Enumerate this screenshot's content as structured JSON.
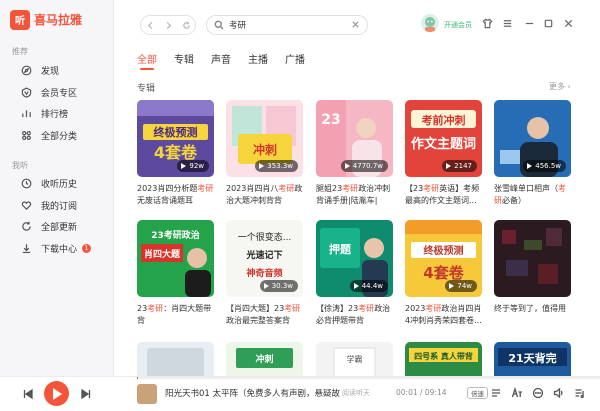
{
  "app": {
    "logo_char": "听",
    "name": "喜马拉雅"
  },
  "sidebar": {
    "section_recommend": "推荐",
    "recommend_items": [
      {
        "label": "发现",
        "icon": "compass-icon"
      },
      {
        "label": "会员专区",
        "icon": "vip-icon"
      },
      {
        "label": "排行榜",
        "icon": "ranking-icon"
      },
      {
        "label": "全部分类",
        "icon": "category-icon"
      }
    ],
    "section_mine": "我听",
    "mine_items": [
      {
        "label": "收听历史",
        "icon": "clock-icon"
      },
      {
        "label": "我的订阅",
        "icon": "heart-icon"
      },
      {
        "label": "全部更新",
        "icon": "refresh-icon"
      },
      {
        "label": "下载中心",
        "icon": "download-icon",
        "badge": "1"
      }
    ]
  },
  "search": {
    "value": "考研"
  },
  "topbar": {
    "vip_label": "开通会员"
  },
  "tabs": [
    "全部",
    "专辑",
    "声音",
    "主播",
    "广播"
  ],
  "active_tab": 0,
  "section": {
    "label": "专辑",
    "more": "更多 ›"
  },
  "albums": [
    {
      "pre": "2023肖四分析题",
      "kw": "考研",
      "post": "无废话背诵题耳",
      "plays": "92w",
      "art": "purple-yellow"
    },
    {
      "pre": "2023肖四肖八",
      "kw": "考研",
      "post": "政治大题冲刺背背",
      "plays": "353.3w",
      "art": "pink-mint"
    },
    {
      "pre": "腿姐23",
      "kw": "考研",
      "post": "政治冲刺背诵手册|陆胤车|大...",
      "plays": "4770.7w",
      "art": "pink-person"
    },
    {
      "pre": "【23",
      "kw": "考研",
      "post": "英语】考频最高的作文主题词...",
      "plays": "2147",
      "art": "red-orange"
    },
    {
      "pre": "张雪峰单口相声（",
      "kw": "考研",
      "post": "必备）",
      "plays": "456.5w",
      "art": "blue-person"
    },
    {
      "pre": "23",
      "kw": "考研",
      "post": "：肖四大题带背",
      "plays": "",
      "art": "green-person"
    },
    {
      "pre": "【肖四大题】23",
      "kw": "考研",
      "post": "政治最完整答案背诵...",
      "plays": "30.3w",
      "art": "white-text"
    },
    {
      "pre": "【徐涛】23",
      "kw": "考研",
      "post": "政治必背押题带背",
      "plays": "44.4w",
      "art": "green-teal"
    },
    {
      "pre": "2023",
      "kw": "考研",
      "post": "政治肖四肖4冲刺肖秀荣四套卷...",
      "plays": "74w",
      "art": "yellow-orange"
    },
    {
      "pre": "终于等到了，值得用",
      "kw": "",
      "post": "",
      "plays": "",
      "art": "dark-pixel"
    },
    {
      "pre": "",
      "kw": "",
      "post": "",
      "plays": "",
      "art": "row3-a"
    },
    {
      "pre": "",
      "kw": "",
      "post": "",
      "plays": "",
      "art": "row3-b"
    },
    {
      "pre": "",
      "kw": "",
      "post": "",
      "plays": "",
      "art": "row3-c"
    },
    {
      "pre": "",
      "kw": "",
      "post": "",
      "plays": "",
      "art": "row3-d"
    },
    {
      "pre": "",
      "kw": "",
      "post": "",
      "plays": "",
      "art": "row3-e"
    }
  ],
  "player": {
    "title": "阳光天书01 太平阵（免费多人有声剧，悬疑故事...",
    "action": "阅读听天",
    "time": "00:01 / 09:14",
    "speed": "倍速",
    "progress": 0.002
  },
  "colors": {
    "accent": "#f4553a",
    "vip": "#3cb878"
  }
}
